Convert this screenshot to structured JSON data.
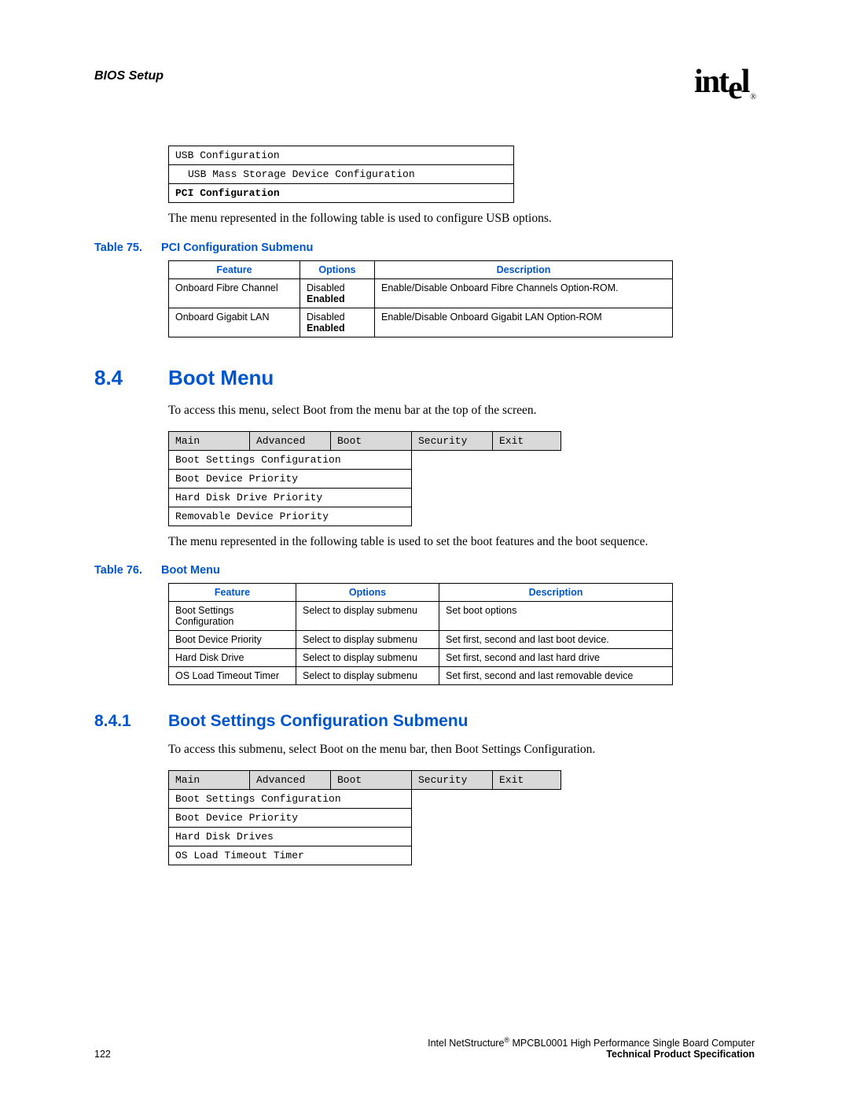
{
  "header": {
    "section": "BIOS Setup",
    "logo": "intel",
    "reg": "®"
  },
  "usb_table": {
    "r1": "USB Configuration",
    "r2": "USB Mass Storage Device Configuration",
    "r3": "PCI Configuration"
  },
  "para1": "The menu represented in the following table is used to configure USB options.",
  "table75": {
    "caption_num": "Table 75.",
    "caption_title": "PCI Configuration Submenu",
    "h1": "Feature",
    "h2": "Options",
    "h3": "Description",
    "r1c1": "Onboard Fibre Channel",
    "r1c2a": "Disabled",
    "r1c2b": "Enabled",
    "r1c3": "Enable/Disable Onboard Fibre Channels Option-ROM.",
    "r2c1": "Onboard Gigabit LAN",
    "r2c2a": "Disabled",
    "r2c2b": "Enabled",
    "r2c3": "Enable/Disable Onboard Gigabit LAN Option-ROM"
  },
  "sec84": {
    "num": "8.4",
    "title": "Boot Menu",
    "para": "To access this menu, select Boot from the menu bar at the top of the screen."
  },
  "menu1": {
    "main": "Main",
    "advanced": "Advanced",
    "boot": "Boot",
    "security": "Security",
    "exit": "Exit",
    "r1": "Boot Settings Configuration",
    "r2": "Boot Device Priority",
    "r3": "Hard Disk Drive Priority",
    "r4": "Removable Device Priority"
  },
  "para2": "The menu represented in the following table is used to set the boot features and the boot sequence.",
  "table76": {
    "caption_num": "Table 76.",
    "caption_title": "Boot Menu",
    "h1": "Feature",
    "h2": "Options",
    "h3": "Description",
    "r1c1": "Boot Settings Configuration",
    "r1c2": "Select to display submenu",
    "r1c3": "Set boot options",
    "r2c1": "Boot Device Priority",
    "r2c2": "Select to display submenu",
    "r2c3": "Set first, second and last boot device.",
    "r3c1": "Hard Disk Drive",
    "r3c2": "Select to display submenu",
    "r3c3": "Set first, second and last hard drive",
    "r4c1": "OS Load Timeout Timer",
    "r4c2": "Select to display submenu",
    "r4c3": "Set first, second and last removable device"
  },
  "sec841": {
    "num": "8.4.1",
    "title": "Boot Settings Configuration Submenu",
    "para": "To access this submenu, select Boot on the menu bar, then Boot Settings Configuration."
  },
  "menu2": {
    "main": "Main",
    "advanced": "Advanced",
    "boot": "Boot",
    "security": "Security",
    "exit": "Exit",
    "r1": "Boot Settings Configuration",
    "r2": "Boot Device Priority",
    "r3": "Hard Disk Drives",
    "r4": "OS Load Timeout Timer"
  },
  "footer": {
    "page": "122",
    "line1a": "Intel NetStructure",
    "line1b": " MPCBL0001 High Performance Single Board Computer",
    "line2": "Technical Product Specification",
    "reg": "®"
  }
}
